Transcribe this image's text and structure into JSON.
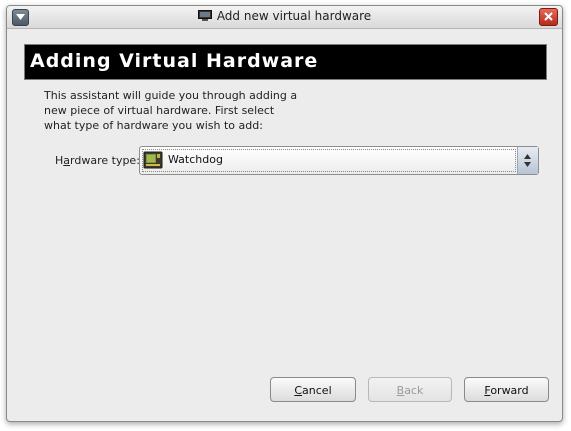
{
  "window": {
    "title": "Add new virtual hardware"
  },
  "header": {
    "title": "Adding Virtual Hardware"
  },
  "intro": {
    "text": "This assistant will guide you through adding a new piece of virtual hardware. First select what type of hardware you wish to add:"
  },
  "hardware": {
    "label_mnemonic": "a",
    "label_pre": "H",
    "label_post": "rdware type:",
    "selected_value": "Watchdog",
    "icon": "hardware-card-icon"
  },
  "buttons": {
    "cancel": {
      "mnemonic": "C",
      "rest": "ancel",
      "enabled": true
    },
    "back": {
      "mnemonic": "B",
      "rest": "ack",
      "enabled": false
    },
    "forward": {
      "mnemonic": "F",
      "rest": "orward",
      "enabled": true
    }
  },
  "colors": {
    "header_bg": "#000000",
    "header_text": "#ffffff",
    "close_button": "#c73a2b"
  }
}
